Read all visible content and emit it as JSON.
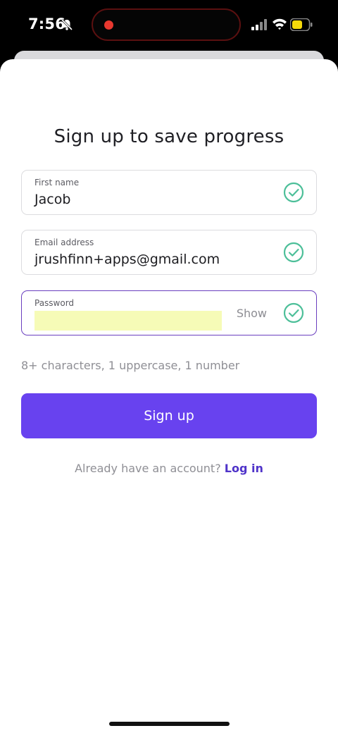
{
  "status_bar": {
    "time": "7:56",
    "icons": [
      "bell-slash-icon",
      "signal-icon",
      "wifi-icon",
      "battery-icon"
    ],
    "recording_indicator_color": "#e8382f",
    "battery_color": "#f5d90a"
  },
  "form": {
    "title": "Sign up to save progress",
    "first_name": {
      "label": "First name",
      "value": "Jacob"
    },
    "email": {
      "label": "Email address",
      "value": "jrushfinn+apps@gmail.com"
    },
    "password": {
      "label": "Password",
      "show_label": "Show"
    },
    "hint": "8+ characters, 1 uppercase, 1 number",
    "submit_label": "Sign up",
    "login_prompt": "Already have an account?",
    "login_link": "Log in"
  },
  "colors": {
    "accent": "#6842ef",
    "link": "#4f33c9",
    "valid_check": "#4dbf99",
    "active_border": "#6a3fbf",
    "autofill_highlight": "#f6fbb7"
  }
}
